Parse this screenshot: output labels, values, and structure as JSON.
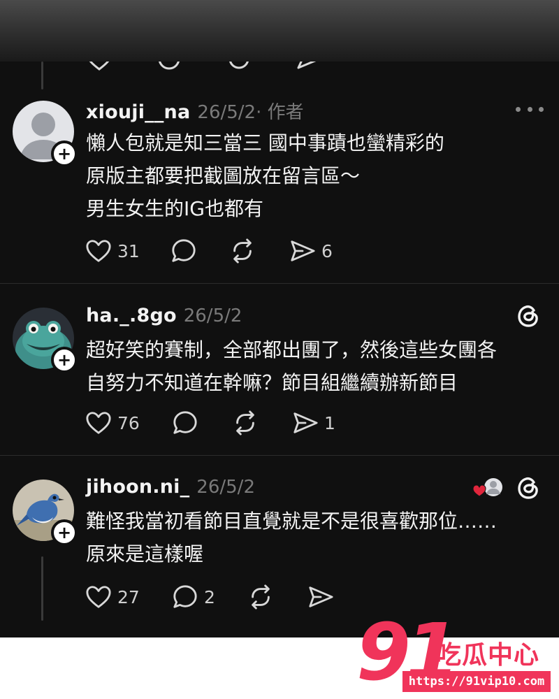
{
  "posts": [
    {
      "username": "xiouji__na",
      "date": "26/5/2",
      "author_tag": " · 作者",
      "lines": [
        "懶人包就是知三當三 國中事蹟也蠻精彩的",
        "原版主都要把截圖放在留言區～",
        "男生女生的IG也都有"
      ],
      "likes": "31",
      "comments": "",
      "reposts": "",
      "shares": "6"
    },
    {
      "username": "ha._.8go",
      "date": "26/5/2",
      "lines": [
        "超好笑的賽制，全部都出團了，然後這些女團各",
        "自努力不知道在幹嘛？節目組繼續辦新節目"
      ],
      "likes": "76",
      "comments": "",
      "reposts": "",
      "shares": "1"
    },
    {
      "username": "jihoon.ni_",
      "date": "26/5/2",
      "lines": [
        "難怪我當初看節目直覺就是不是很喜歡那位……",
        "原來是這樣喔"
      ],
      "likes": "27",
      "comments": "2",
      "reposts": "",
      "shares": ""
    }
  ],
  "icons": {
    "like": "heart-icon",
    "comment": "comment-icon",
    "repost": "repost-icon",
    "share": "share-icon",
    "follow": "plus-icon",
    "more": "more-icon",
    "threads": "threads-logo-icon"
  },
  "colors": {
    "background": "#101010",
    "text": "#f3f3f3",
    "muted": "#7a7a7a",
    "watermark": "#f0345a",
    "like_heart": "#e0263c"
  },
  "watermark": {
    "number": "91",
    "name": "吃瓜中心",
    "url": "https://91vip10.com"
  }
}
